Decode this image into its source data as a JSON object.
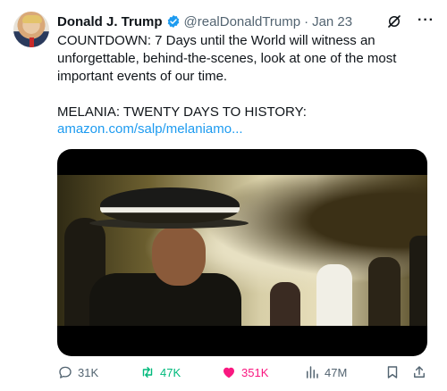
{
  "tweet": {
    "author_name": "Donald J. Trump",
    "handle": "@realDonaldTrump",
    "separator": "·",
    "date": "Jan 23",
    "more_label": "···",
    "text": "COUNTDOWN: 7 Days until the World will witness an unforgettable, behind-the-scenes, look at one of the most important events of our time.\n\nMELANIA: TWENTY DAYS TO HISTORY:",
    "link": "amazon.com/salp/melaniamo..."
  },
  "colors": {
    "link": "#1d9bf0",
    "retweet": "#00ba7c",
    "like": "#f91880",
    "verified": "#1d9bf0",
    "muted": "#536471"
  },
  "actions": {
    "replies": "31K",
    "reposts": "47K",
    "likes": "351K",
    "views": "47M"
  },
  "icons": [
    "verified-badge-icon",
    "grok-icon",
    "reply-icon",
    "repost-icon",
    "heart-icon",
    "views-icon",
    "bookmark-icon",
    "share-icon"
  ]
}
